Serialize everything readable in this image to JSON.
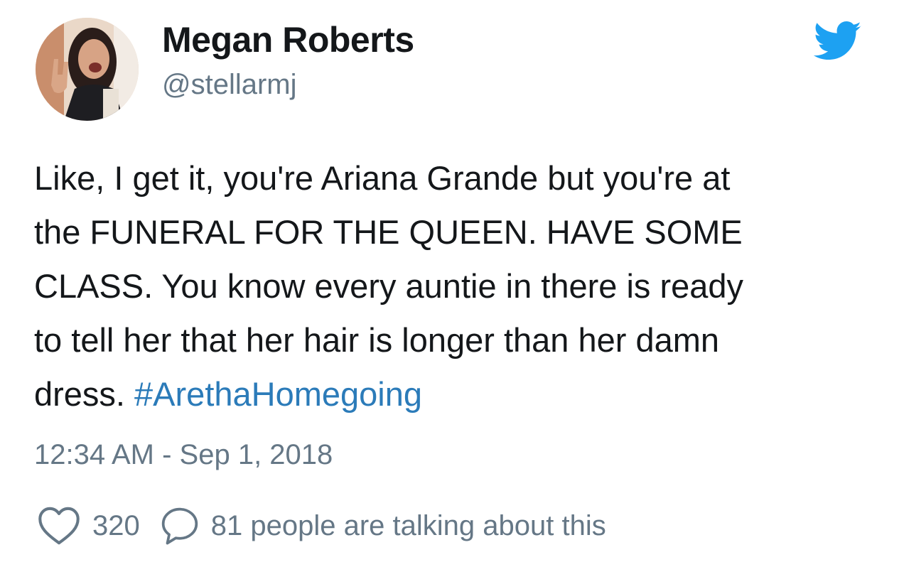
{
  "author": {
    "display_name": "Megan Roberts",
    "handle": "@stellarmj",
    "avatar_alt": "avatar"
  },
  "brand": {
    "icon": "twitter-bird-icon",
    "color": "#1da1f2"
  },
  "tweet": {
    "lines": [
      "Like, I get it, you're Ariana Grande but you're at",
      "the FUNERAL FOR THE QUEEN. HAVE SOME",
      "CLASS. You know every auntie in there is ready",
      "to tell her that her hair is longer than her damn"
    ],
    "last_line_prefix": "dress. ",
    "hashtag": "#ArethaHomegoing",
    "hashtag_color": "#2b7bb9"
  },
  "timestamp": "12:34 AM - Sep 1, 2018",
  "actions": {
    "like_icon": "heart-outline-icon",
    "like_count": "320",
    "reply_icon": "speech-bubble-icon",
    "talking_text": "81 people are talking about this"
  },
  "colors": {
    "text": "#14171a",
    "secondary": "#657786"
  }
}
